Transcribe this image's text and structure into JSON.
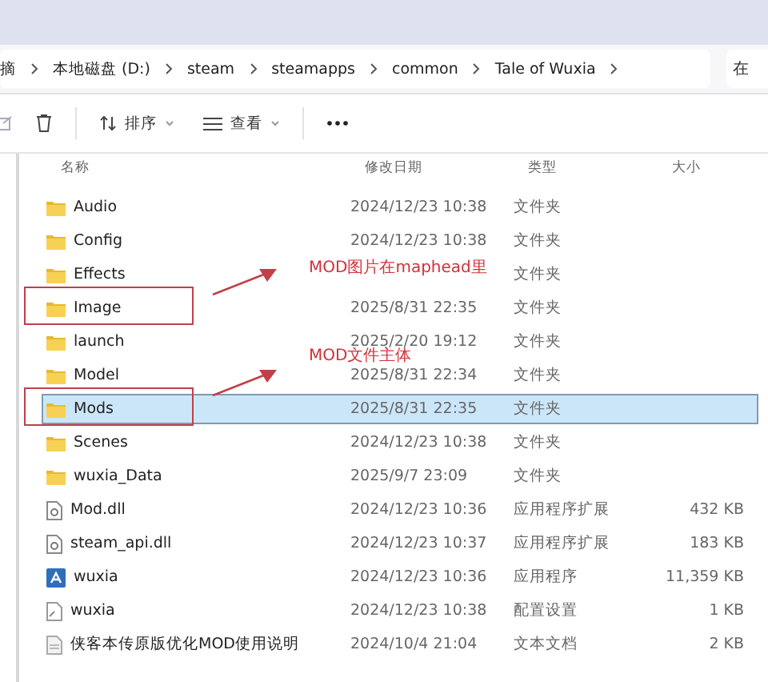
{
  "address_bar": {
    "crumbs": [
      "摘",
      "本地磁盘 (D:)",
      "steam",
      "steamapps",
      "common",
      "Tale of Wuxia"
    ]
  },
  "search": {
    "placeholder": "在"
  },
  "toolbar": {
    "sort": "排序",
    "view": "查看"
  },
  "columns": [
    "名称",
    "修改日期",
    "类型",
    "大小"
  ],
  "rows": [
    {
      "kind": "folder",
      "name": "Audio",
      "date": "2024/12/23 10:38",
      "type": "文件夹",
      "selected": false
    },
    {
      "kind": "folder",
      "name": "Config",
      "date": "2024/12/23 10:38",
      "type": "文件夹",
      "selected": false
    },
    {
      "kind": "folder",
      "name": "Effects",
      "type": "文件夹",
      "selected": false
    },
    {
      "kind": "folder",
      "name": "Image",
      "date": "2025/8/31 22:35",
      "type": "文件夹",
      "selected": false
    },
    {
      "kind": "folder",
      "name": "launch",
      "date": "2025/2/20 19:12",
      "type": "文件夹",
      "selected": false
    },
    {
      "kind": "folder",
      "name": "Model",
      "date": "2025/8/31 22:34",
      "type": "文件夹",
      "selected": false
    },
    {
      "kind": "folder",
      "name": "Mods",
      "date": "2025/8/31 22:35",
      "type": "文件夹",
      "selected": true
    },
    {
      "kind": "folder",
      "name": "Scenes",
      "date": "2024/12/23 10:38",
      "type": "文件夹",
      "selected": false
    },
    {
      "kind": "folder",
      "name": "wuxia_Data",
      "date": "2025/9/7 23:09",
      "type": "文件夹",
      "selected": false
    },
    {
      "kind": "dll",
      "name": "Mod.dll",
      "date": "2024/12/23 10:36",
      "type": "应用程序扩展",
      "size": "432 KB",
      "selected": false
    },
    {
      "kind": "dll",
      "name": "steam_api.dll",
      "date": "2024/12/23 10:37",
      "type": "应用程序扩展",
      "size": "183 KB",
      "selected": false
    },
    {
      "kind": "app",
      "name": "wuxia",
      "date": "2024/12/23 10:36",
      "type": "应用程序",
      "size": "11,359 KB",
      "selected": false
    },
    {
      "kind": "config",
      "name": "wuxia",
      "date": "2024/12/23 10:38",
      "type": "配置设置",
      "size": "1 KB",
      "selected": false
    },
    {
      "kind": "text",
      "name": "侠客本传原版优化MOD使用说明",
      "date": "2024/10/4 21:04",
      "type": "文本文档",
      "size": "2 KB",
      "selected": false
    }
  ],
  "annotations": [
    {
      "text": "MOD图片在maphead里"
    },
    {
      "text": "MOD文件主体"
    }
  ]
}
